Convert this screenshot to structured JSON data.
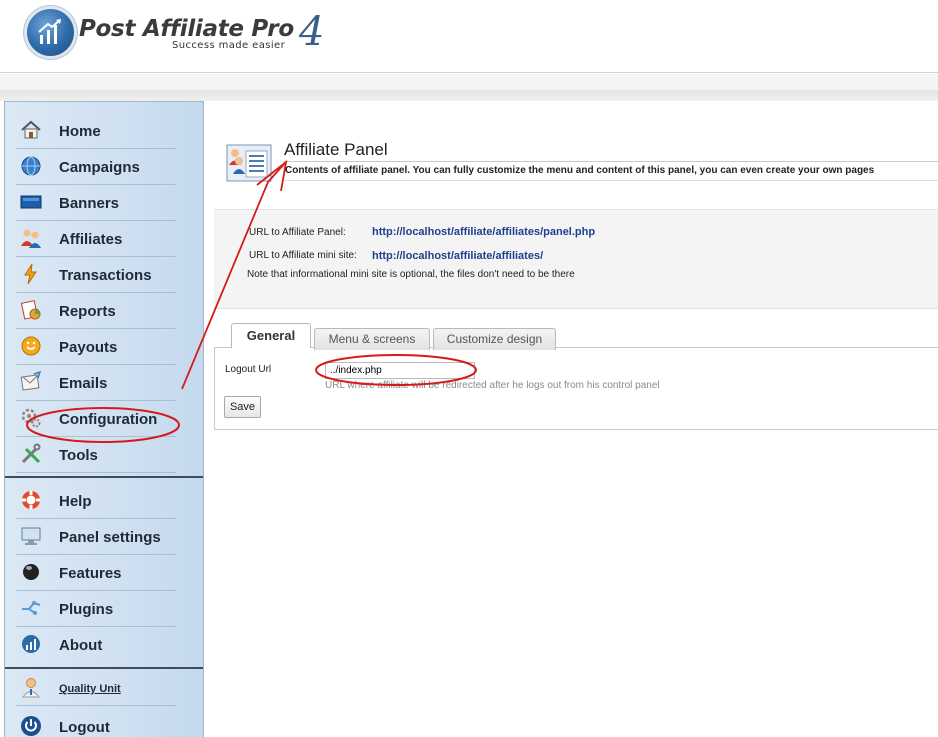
{
  "header": {
    "logo_title": "Post Affiliate Pro",
    "logo_version": "4",
    "logo_tagline": "Success made easier"
  },
  "sidebar": {
    "items": [
      {
        "label": "Home",
        "icon": "home-icon"
      },
      {
        "label": "Campaigns",
        "icon": "campaigns-icon"
      },
      {
        "label": "Banners",
        "icon": "banners-icon"
      },
      {
        "label": "Affiliates",
        "icon": "affiliates-icon"
      },
      {
        "label": "Transactions",
        "icon": "transactions-icon"
      },
      {
        "label": "Reports",
        "icon": "reports-icon"
      },
      {
        "label": "Payouts",
        "icon": "payouts-icon"
      },
      {
        "label": "Emails",
        "icon": "emails-icon"
      },
      {
        "label": "Configuration",
        "icon": "configuration-icon"
      },
      {
        "label": "Tools",
        "icon": "tools-icon"
      }
    ],
    "items2": [
      {
        "label": "Help",
        "icon": "help-icon"
      },
      {
        "label": "Panel settings",
        "icon": "panel-settings-icon"
      },
      {
        "label": "Features",
        "icon": "features-icon"
      },
      {
        "label": "Plugins",
        "icon": "plugins-icon"
      },
      {
        "label": "About",
        "icon": "about-icon"
      }
    ],
    "items3": [
      {
        "label": "Quality Unit",
        "icon": "user-icon"
      },
      {
        "label": "Logout",
        "icon": "logout-icon"
      }
    ]
  },
  "main": {
    "title": "Affiliate Panel",
    "description": "Contents of affiliate panel. You can fully customize the menu and content of this panel, you can even create your own pages",
    "info": {
      "panel_url_label": "URL to Affiliate Panel:",
      "panel_url": "http://localhost/affiliate/affiliates/panel.php",
      "mini_site_label": "URL to Affiliate mini site:",
      "mini_site_url": "http://localhost/affiliate/affiliates/",
      "note": "Note that informational mini site is optional, the files don't need to be there"
    },
    "tabs": [
      {
        "label": "General",
        "active": true
      },
      {
        "label": "Menu & screens",
        "active": false
      },
      {
        "label": "Customize design",
        "active": false
      }
    ],
    "form": {
      "logout_url_label": "Logout Url",
      "logout_url_value": "../index.php",
      "logout_url_help": "URL where affiliate will be redirected after he logs out from his control panel",
      "save_label": "Save"
    }
  },
  "colors": {
    "annotation": "#d61a1a",
    "link": "#1e3f8f",
    "sidebar_bg": "#cfe0f1"
  }
}
